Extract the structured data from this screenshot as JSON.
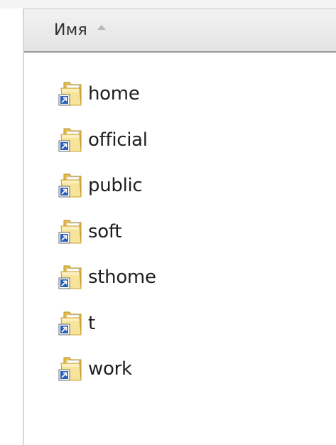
{
  "column_header": {
    "name_label": "Имя",
    "sort_direction": "ascending"
  },
  "items": [
    {
      "name": "home",
      "icon": "folder-shortcut-icon"
    },
    {
      "name": "official",
      "icon": "folder-shortcut-icon"
    },
    {
      "name": "public",
      "icon": "folder-shortcut-icon"
    },
    {
      "name": "soft",
      "icon": "folder-shortcut-icon"
    },
    {
      "name": "sthome",
      "icon": "folder-shortcut-icon"
    },
    {
      "name": "t",
      "icon": "folder-shortcut-icon"
    },
    {
      "name": "work",
      "icon": "folder-shortcut-icon"
    }
  ],
  "colors": {
    "folder_light": "#f6e39a",
    "folder_dark": "#e0b94a",
    "shortcut_arrow_bg": "#2a5fb5"
  }
}
